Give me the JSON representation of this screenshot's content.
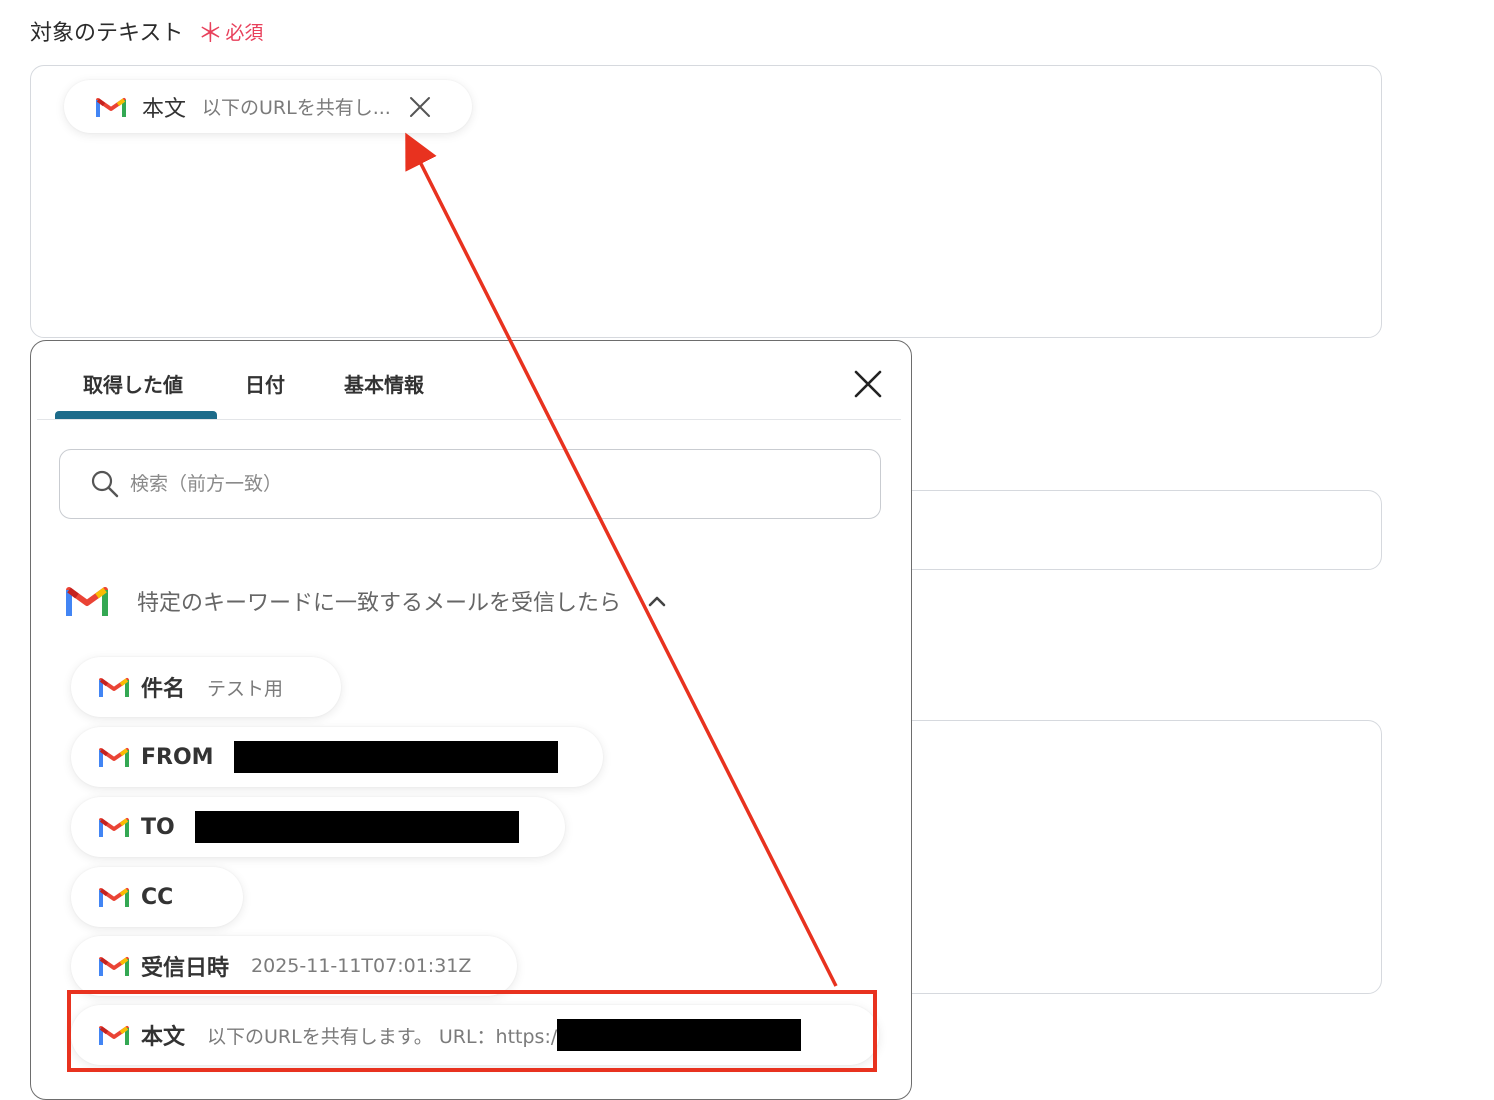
{
  "field": {
    "label": "対象のテキスト",
    "required_label": "必須",
    "required_mark": "＊",
    "chip": {
      "icon": "gmail-icon",
      "name": "本文",
      "value": "以下のURLを共有し..."
    }
  },
  "popover": {
    "tabs": [
      "取得した値",
      "日付",
      "基本情報"
    ],
    "active_tab": "取得した値",
    "search_placeholder": "検索（前方一致）",
    "section": {
      "icon": "gmail-icon",
      "title": "特定のキーワードに一致するメールを受信したら",
      "expanded": true
    },
    "items": [
      {
        "name": "件名",
        "value": "テスト用",
        "redacted": false
      },
      {
        "name": "FROM",
        "value": "",
        "redacted": true
      },
      {
        "name": "TO",
        "value": "",
        "redacted": true
      },
      {
        "name": "CC",
        "value": "",
        "redacted": false
      },
      {
        "name": "受信日時",
        "value": "2025-11-11T07:01:31Z",
        "redacted": false
      },
      {
        "name": "本文",
        "value": "以下のURLを共有します。 URL：https:/",
        "redacted": true,
        "highlighted": true
      }
    ]
  },
  "colors": {
    "required": "#e8405b",
    "tab_active_underline": "#1c6b8a",
    "annotation": "#e8321f",
    "redaction": "#000000"
  }
}
